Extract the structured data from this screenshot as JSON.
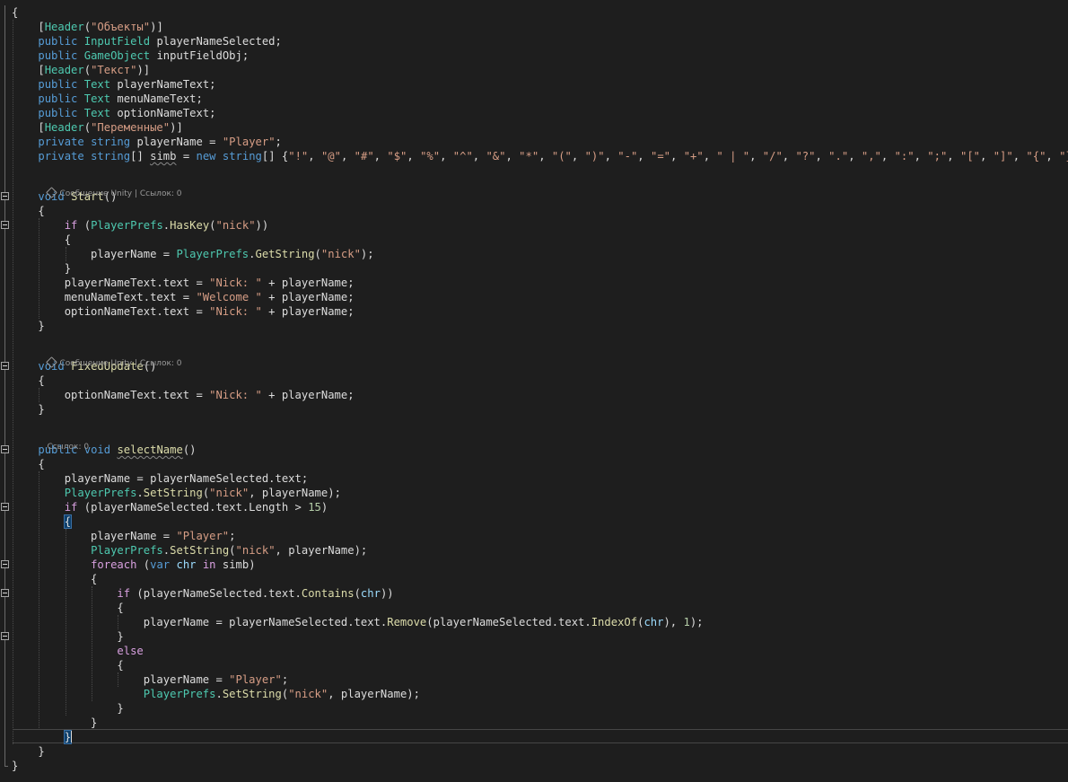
{
  "editor": {
    "theme": "dark",
    "background": "#1e1e1e",
    "colors": {
      "keyword": "#569cd6",
      "type": "#4ec9b0",
      "string": "#d69d85",
      "number": "#b5cea8",
      "control": "#d8a0df",
      "plain": "#dcdcdc",
      "local": "#9cdcfe",
      "method": "#dcdcaa"
    },
    "icons": {
      "fold": "collapse-minus-icon",
      "unity": "unity-logo-icon"
    }
  },
  "code_lens": {
    "start": "Сообщение Unity | Ссылок: 0",
    "fixed_update": "Сообщение Unity | Ссылок: 0",
    "select_name": "Ссылок: 0"
  },
  "lines": [
    [
      [
        "pl",
        "{"
      ]
    ],
    [
      [
        "pl",
        "    ["
      ],
      [
        "ty",
        "Header"
      ],
      [
        "pl",
        "("
      ],
      [
        "st",
        "\"Объекты\""
      ],
      [
        "pl",
        ")]"
      ]
    ],
    [
      [
        "pl",
        "    "
      ],
      [
        "kw",
        "public"
      ],
      [
        "pl",
        " "
      ],
      [
        "ty",
        "InputField"
      ],
      [
        "pl",
        " playerNameSelected;"
      ]
    ],
    [
      [
        "pl",
        "    "
      ],
      [
        "kw",
        "public"
      ],
      [
        "pl",
        " "
      ],
      [
        "ty",
        "GameObject"
      ],
      [
        "pl",
        " inputFieldObj;"
      ]
    ],
    [
      [
        "pl",
        "    ["
      ],
      [
        "ty",
        "Header"
      ],
      [
        "pl",
        "("
      ],
      [
        "st",
        "\"Текст\""
      ],
      [
        "pl",
        ")]"
      ]
    ],
    [
      [
        "pl",
        "    "
      ],
      [
        "kw",
        "public"
      ],
      [
        "pl",
        " "
      ],
      [
        "ty",
        "Text"
      ],
      [
        "pl",
        " playerNameText;"
      ]
    ],
    [
      [
        "pl",
        "    "
      ],
      [
        "kw",
        "public"
      ],
      [
        "pl",
        " "
      ],
      [
        "ty",
        "Text"
      ],
      [
        "pl",
        " menuNameText;"
      ]
    ],
    [
      [
        "pl",
        "    "
      ],
      [
        "kw",
        "public"
      ],
      [
        "pl",
        " "
      ],
      [
        "ty",
        "Text"
      ],
      [
        "pl",
        " optionNameText;"
      ]
    ],
    [
      [
        "pl",
        "    ["
      ],
      [
        "ty",
        "Header"
      ],
      [
        "pl",
        "("
      ],
      [
        "st",
        "\"Переменные\""
      ],
      [
        "pl",
        ")]"
      ]
    ],
    [
      [
        "pl",
        "    "
      ],
      [
        "kw",
        "private"
      ],
      [
        "pl",
        " "
      ],
      [
        "kw",
        "string"
      ],
      [
        "pl",
        " playerName = "
      ],
      [
        "st",
        "\"Player\""
      ],
      [
        "pl",
        ";"
      ]
    ],
    [
      [
        "pl",
        "    "
      ],
      [
        "kw",
        "private"
      ],
      [
        "pl",
        " "
      ],
      [
        "kw",
        "string"
      ],
      [
        "pl",
        "[] "
      ],
      [
        "sq",
        "simb"
      ],
      [
        "pl",
        " = "
      ],
      [
        "kw",
        "new"
      ],
      [
        "pl",
        " "
      ],
      [
        "kw",
        "string"
      ],
      [
        "pl",
        "[] {"
      ],
      [
        "st",
        "\"!\""
      ],
      [
        "pl",
        ", "
      ],
      [
        "st",
        "\"@\""
      ],
      [
        "pl",
        ", "
      ],
      [
        "st",
        "\"#\""
      ],
      [
        "pl",
        ", "
      ],
      [
        "st",
        "\"$\""
      ],
      [
        "pl",
        ", "
      ],
      [
        "st",
        "\"%\""
      ],
      [
        "pl",
        ", "
      ],
      [
        "st",
        "\"^\""
      ],
      [
        "pl",
        ", "
      ],
      [
        "st",
        "\"&\""
      ],
      [
        "pl",
        ", "
      ],
      [
        "st",
        "\"*\""
      ],
      [
        "pl",
        ", "
      ],
      [
        "st",
        "\"(\""
      ],
      [
        "pl",
        ", "
      ],
      [
        "st",
        "\")\""
      ],
      [
        "pl",
        ", "
      ],
      [
        "st",
        "\"-\""
      ],
      [
        "pl",
        ", "
      ],
      [
        "st",
        "\"=\""
      ],
      [
        "pl",
        ", "
      ],
      [
        "st",
        "\"+\""
      ],
      [
        "pl",
        ", "
      ],
      [
        "st",
        "\" | \""
      ],
      [
        "pl",
        ", "
      ],
      [
        "st",
        "\"/\""
      ],
      [
        "pl",
        ", "
      ],
      [
        "st",
        "\"?\""
      ],
      [
        "pl",
        ", "
      ],
      [
        "st",
        "\".\""
      ],
      [
        "pl",
        ", "
      ],
      [
        "st",
        "\",\""
      ],
      [
        "pl",
        ", "
      ],
      [
        "st",
        "\":\""
      ],
      [
        "pl",
        ", "
      ],
      [
        "st",
        "\";\""
      ],
      [
        "pl",
        ", "
      ],
      [
        "st",
        "\"[\""
      ],
      [
        "pl",
        ", "
      ],
      [
        "st",
        "\"]\""
      ],
      [
        "pl",
        ", "
      ],
      [
        "st",
        "\"{\""
      ],
      [
        "pl",
        ", "
      ],
      [
        "st",
        "\"}\""
      ],
      [
        "pl",
        "};"
      ]
    ],
    [
      [
        "pl",
        "    "
      ],
      [
        "kw",
        "void"
      ],
      [
        "pl",
        " "
      ],
      [
        "fn",
        "Start"
      ],
      [
        "pl",
        "()"
      ]
    ],
    [
      [
        "pl",
        "    {"
      ]
    ],
    [
      [
        "pl",
        "        "
      ],
      [
        "ct",
        "if"
      ],
      [
        "pl",
        " ("
      ],
      [
        "ty",
        "PlayerPrefs"
      ],
      [
        "pl",
        "."
      ],
      [
        "fn",
        "HasKey"
      ],
      [
        "pl",
        "("
      ],
      [
        "st",
        "\"nick\""
      ],
      [
        "pl",
        "))"
      ]
    ],
    [
      [
        "pl",
        "        {"
      ]
    ],
    [
      [
        "pl",
        "            playerName = "
      ],
      [
        "ty",
        "PlayerPrefs"
      ],
      [
        "pl",
        "."
      ],
      [
        "fn",
        "GetString"
      ],
      [
        "pl",
        "("
      ],
      [
        "st",
        "\"nick\""
      ],
      [
        "pl",
        ");"
      ]
    ],
    [
      [
        "pl",
        "        }"
      ]
    ],
    [
      [
        "pl",
        "        playerNameText.text = "
      ],
      [
        "st",
        "\"Nick: \""
      ],
      [
        "pl",
        " + playerName;"
      ]
    ],
    [
      [
        "pl",
        "        menuNameText.text = "
      ],
      [
        "st",
        "\"Welcome \""
      ],
      [
        "pl",
        " + playerName;"
      ]
    ],
    [
      [
        "pl",
        "        optionNameText.text = "
      ],
      [
        "st",
        "\"Nick: \""
      ],
      [
        "pl",
        " + playerName;"
      ]
    ],
    [
      [
        "pl",
        "    }"
      ]
    ],
    [
      [
        "pl",
        "    "
      ],
      [
        "kw",
        "void"
      ],
      [
        "pl",
        " "
      ],
      [
        "fn",
        "FixedUpdate"
      ],
      [
        "pl",
        "()"
      ]
    ],
    [
      [
        "pl",
        "    {"
      ]
    ],
    [
      [
        "pl",
        "        optionNameText.text = "
      ],
      [
        "st",
        "\"Nick: \""
      ],
      [
        "pl",
        " + playerName;"
      ]
    ],
    [
      [
        "pl",
        "    }"
      ]
    ],
    [
      [
        "pl",
        "    "
      ],
      [
        "kw",
        "public"
      ],
      [
        "pl",
        " "
      ],
      [
        "kw",
        "void"
      ],
      [
        "pl",
        " "
      ],
      [
        "sqf",
        "selectName"
      ],
      [
        "pl",
        "()"
      ]
    ],
    [
      [
        "pl",
        "    {"
      ]
    ],
    [
      [
        "pl",
        "        playerName = playerNameSelected.text;"
      ]
    ],
    [
      [
        "pl",
        "        "
      ],
      [
        "ty",
        "PlayerPrefs"
      ],
      [
        "pl",
        "."
      ],
      [
        "fn",
        "SetString"
      ],
      [
        "pl",
        "("
      ],
      [
        "st",
        "\"nick\""
      ],
      [
        "pl",
        ", playerName);"
      ]
    ],
    [
      [
        "pl",
        "        "
      ],
      [
        "ct",
        "if"
      ],
      [
        "pl",
        " (playerNameSelected.text.Length > "
      ],
      [
        "nu",
        "15"
      ],
      [
        "pl",
        ")"
      ]
    ],
    [
      [
        "pl",
        "        "
      ],
      [
        "bm",
        "{"
      ]
    ],
    [
      [
        "pl",
        "            playerName = "
      ],
      [
        "st",
        "\"Player\""
      ],
      [
        "pl",
        ";"
      ]
    ],
    [
      [
        "pl",
        "            "
      ],
      [
        "ty",
        "PlayerPrefs"
      ],
      [
        "pl",
        "."
      ],
      [
        "fn",
        "SetString"
      ],
      [
        "pl",
        "("
      ],
      [
        "st",
        "\"nick\""
      ],
      [
        "pl",
        ", playerName);"
      ]
    ],
    [
      [
        "pl",
        "            "
      ],
      [
        "ct",
        "foreach"
      ],
      [
        "pl",
        " ("
      ],
      [
        "kw",
        "var"
      ],
      [
        "pl",
        " "
      ],
      [
        "lc",
        "chr"
      ],
      [
        "pl",
        " "
      ],
      [
        "ct",
        "in"
      ],
      [
        "pl",
        " simb)"
      ]
    ],
    [
      [
        "pl",
        "            {"
      ]
    ],
    [
      [
        "pl",
        "                "
      ],
      [
        "ct",
        "if"
      ],
      [
        "pl",
        " (playerNameSelected.text."
      ],
      [
        "fn",
        "Contains"
      ],
      [
        "pl",
        "("
      ],
      [
        "lc",
        "chr"
      ],
      [
        "pl",
        "))"
      ]
    ],
    [
      [
        "pl",
        "                {"
      ]
    ],
    [
      [
        "pl",
        "                    playerName = playerNameSelected.text."
      ],
      [
        "fn",
        "Remove"
      ],
      [
        "pl",
        "(playerNameSelected.text."
      ],
      [
        "fn",
        "IndexOf"
      ],
      [
        "pl",
        "("
      ],
      [
        "lc",
        "chr"
      ],
      [
        "pl",
        "), "
      ],
      [
        "nu",
        "1"
      ],
      [
        "pl",
        ");"
      ]
    ],
    [
      [
        "pl",
        "                }"
      ]
    ],
    [
      [
        "pl",
        "                "
      ],
      [
        "ct",
        "else"
      ]
    ],
    [
      [
        "pl",
        "                {"
      ]
    ],
    [
      [
        "pl",
        "                    playerName = "
      ],
      [
        "st",
        "\"Player\""
      ],
      [
        "pl",
        ";"
      ]
    ],
    [
      [
        "pl",
        "                    "
      ],
      [
        "ty",
        "PlayerPrefs"
      ],
      [
        "pl",
        "."
      ],
      [
        "fn",
        "SetString"
      ],
      [
        "pl",
        "("
      ],
      [
        "st",
        "\"nick\""
      ],
      [
        "pl",
        ", playerName);"
      ]
    ],
    [
      [
        "pl",
        "                }"
      ]
    ],
    [
      [
        "pl",
        "            }"
      ]
    ],
    [
      [
        "pl",
        "        "
      ],
      [
        "bm",
        "}"
      ]
    ],
    [
      [
        "pl",
        "    }"
      ]
    ],
    [
      [
        "pl",
        "}"
      ]
    ]
  ]
}
